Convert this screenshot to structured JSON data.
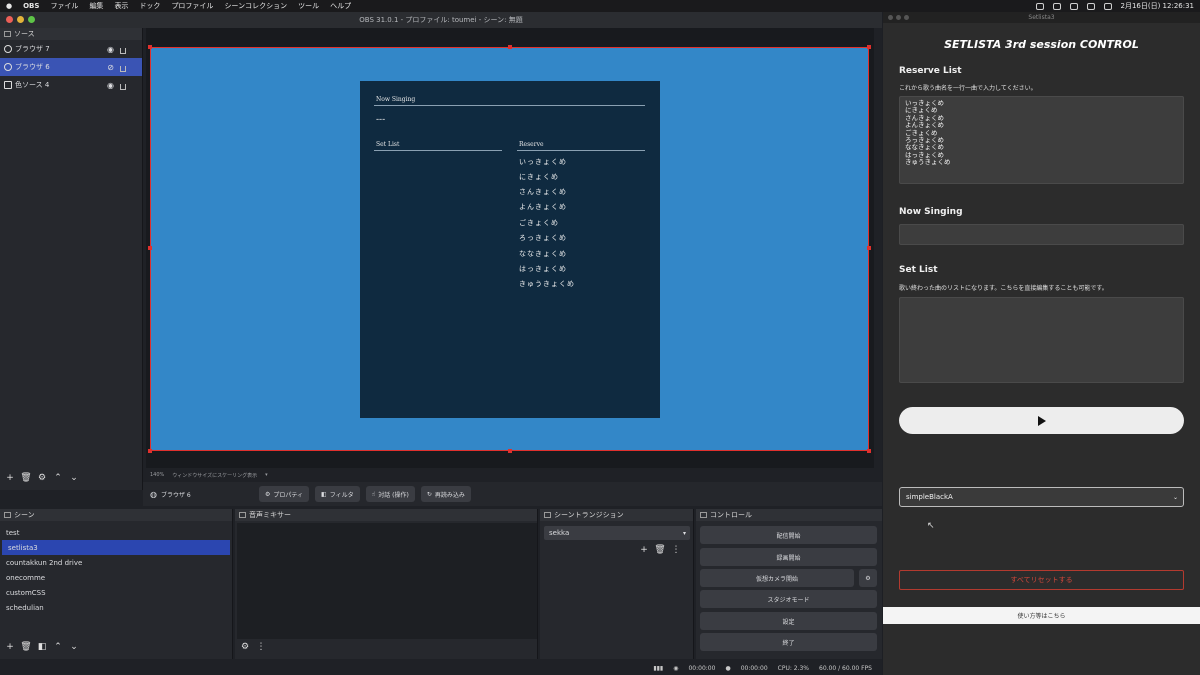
{
  "menubar": {
    "app": "OBS",
    "items": [
      "ファイル",
      "編集",
      "表示",
      "ドック",
      "プロファイル",
      "シーンコレクション",
      "ツール",
      "ヘルプ"
    ],
    "date_time": "2月16日(日)  12:26:31"
  },
  "obs": {
    "window_title": "OBS 31.0.1 - プロファイル: toumei - シーン: 無題",
    "sources_dock_title": "ソース",
    "sources": [
      {
        "label": "ブラウザ 7",
        "selected": false
      },
      {
        "label": "ブラウザ 6",
        "selected": true
      },
      {
        "label": "色ソース 4",
        "selected": false
      }
    ],
    "zoom_label": "140%",
    "scaling_label": "ウィンドウサイズにスケーリング表示",
    "source_toolbar": {
      "current_source": "ブラウザ 6",
      "properties": "プロパティ",
      "filters": "フィルタ",
      "interact": "対話 (操作)",
      "reload": "再読み込み"
    },
    "scenes_dock_title": "シーン",
    "scenes": [
      {
        "label": "test",
        "selected": false
      },
      {
        "label": "setlista3",
        "selected": true
      },
      {
        "label": "countakkun 2nd drive",
        "selected": false
      },
      {
        "label": "onecomme",
        "selected": false
      },
      {
        "label": "customCSS",
        "selected": false
      },
      {
        "label": "schedulian",
        "selected": false
      }
    ],
    "mixer_dock_title": "音声ミキサー",
    "transitions_dock_title": "シーントランジション",
    "transition_value": "sekka",
    "controls_dock_title": "コントロール",
    "controls": {
      "stream": "配信開始",
      "record": "録画開始",
      "virtual_cam": "仮想カメラ開始",
      "studio": "スタジオモード",
      "settings": "設定",
      "exit": "終了"
    },
    "status": {
      "stream_time": "00:00:00",
      "record_time": "00:00:00",
      "cpu": "CPU: 2.3%",
      "fps": "60.00 / 60.00 FPS"
    }
  },
  "overlay": {
    "now_singing_label": "Now Singing",
    "now_singing_value": "---",
    "setlist_label": "Set List",
    "reserve_label": "Reserve",
    "reserve_items": [
      "いっきょくめ",
      "にきょくめ",
      "さんきょくめ",
      "よんきょくめ",
      "ごきょくめ",
      "ろっきょくめ",
      "ななきょくめ",
      "はっきょくめ",
      "きゅうきょくめ"
    ]
  },
  "setlista": {
    "window_title": "Setlista3",
    "heading": "SETLISTA 3rd session CONTROL",
    "reserve_heading": "Reserve List",
    "reserve_help": "これから歌う曲名を一行一曲で入力してください。",
    "reserve_text": "いっきょくめ\nにきょくめ\nさんきょくめ\nよんきょくめ\nごきょくめ\nろっきょくめ\nななきょくめ\nはっきょくめ\nきゅうきょくめ",
    "now_singing_heading": "Now Singing",
    "now_singing_value": "",
    "setlist_heading": "Set List",
    "setlist_help": "歌い終わった曲のリストになります。こちらを直接編集することも可能です。",
    "setlist_text": "",
    "theme_value": "simpleBlackA",
    "reset_label": "すべてリセットする",
    "help_link": "使い方等はこちら"
  },
  "colors": {
    "canvas_bg": "#3387c8",
    "overlay_bg": "#0f2a40",
    "selection": "#e0302d",
    "accent_blue": "#2b46b0",
    "reset_red": "#d4473a"
  }
}
